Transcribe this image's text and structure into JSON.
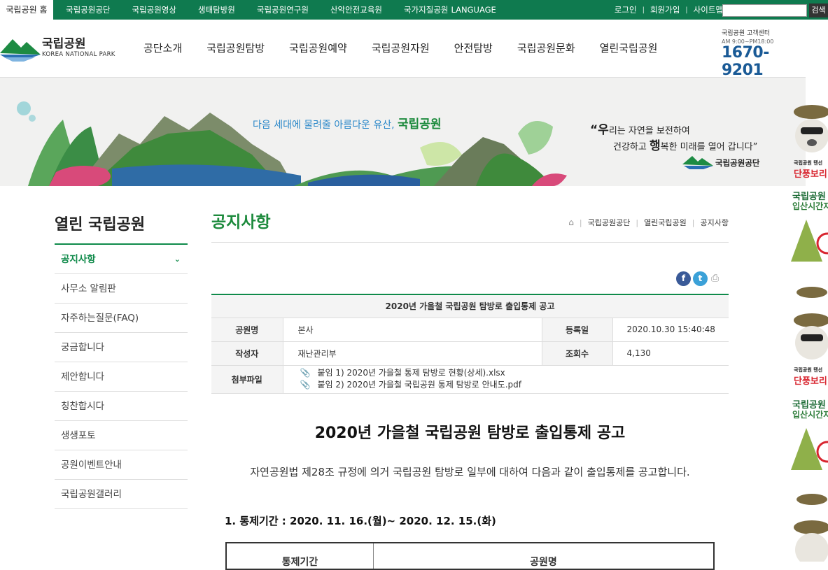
{
  "topbar": {
    "home": "국립공원 홈",
    "links": [
      "국립공원공단",
      "국립공원영상",
      "생태탐방원",
      "국립공원연구원",
      "산악안전교육원",
      "국가지질공원",
      "LANGUAGE"
    ],
    "login": "로그인",
    "join": "회원가입",
    "sitemap": "사이트맵",
    "search_placeholder": "",
    "search_button": "검색"
  },
  "header": {
    "logo_title": "국립공원",
    "logo_sub": "KOREA NATIONAL PARK",
    "gnb": [
      "공단소개",
      "국립공원탐방",
      "국립공원예약",
      "국립공원자원",
      "안전탐방",
      "국립공원문화",
      "열린국립공원"
    ],
    "cs_label": "국립공원 고객센터",
    "cs_hours": "AM 9:00~PM18:00",
    "cs_phone": "1670-9201"
  },
  "banner": {
    "slogan_pre": "다음 세대에 물려줄 아름다운 유산, ",
    "slogan_bold": "국립공원",
    "quote_line1_big": "“우",
    "quote_line1_rest": "리는 자연을 보전하여",
    "quote_line2_pre": "건강하고 ",
    "quote_line2_big": "행",
    "quote_line2_rest": "복한 미래를 열어 갑니다”",
    "org": "국립공원공단"
  },
  "float": {
    "label_small": "국립공원 탠선",
    "label_red": "단풍보리",
    "label_green1": "국립공원",
    "label_green2": "입산시간지"
  },
  "lnb": {
    "title": "열린 국립공원",
    "items": [
      "공지사항",
      "사무소 알림판",
      "자주하는질문(FAQ)",
      "궁금합니다",
      "제안합니다",
      "칭찬합시다",
      "생생포토",
      "공원이벤트안내",
      "국립공원갤러리"
    ]
  },
  "content": {
    "page_title": "공지사항",
    "breadcrumb": [
      "국립공원공단",
      "열린국립공원",
      "공지사항"
    ],
    "share": {
      "facebook": "f",
      "twitter": "t"
    },
    "board": {
      "caption": "2020년 가을철 국립공원 탐방로 출입통제 공고",
      "park_label": "공원명",
      "park_value": "본사",
      "date_label": "등록일",
      "date_value": "2020.10.30 15:40:48",
      "author_label": "작성자",
      "author_value": "재난관리부",
      "views_label": "조회수",
      "views_value": "4,130",
      "files_label": "첨부파일",
      "files": [
        "붙임 1) 2020년 가을철 통제 탐방로 현황(상세).xlsx",
        "붙임 2) 2020년 가을철 국립공원 통제 탐방로 안내도.pdf"
      ]
    },
    "doc_title": "2020년 가을철 국립공원 탐방로 출입통제 공고",
    "doc_para": "자연공원법 제28조 규정에 의거 국립공원 탐방로 일부에 대하여 다음과 같이 출입통제를 공고합니다.",
    "doc_sub": "1. 통제기간 : 2020. 11. 16.(월)~ 2020. 12. 15.(화)",
    "table_headers": [
      "통제기간",
      "공원명"
    ]
  },
  "colors": {
    "topbar": "#0f7a4f",
    "accent_green": "#1c8a3c",
    "phone_blue": "#1a5a96"
  }
}
